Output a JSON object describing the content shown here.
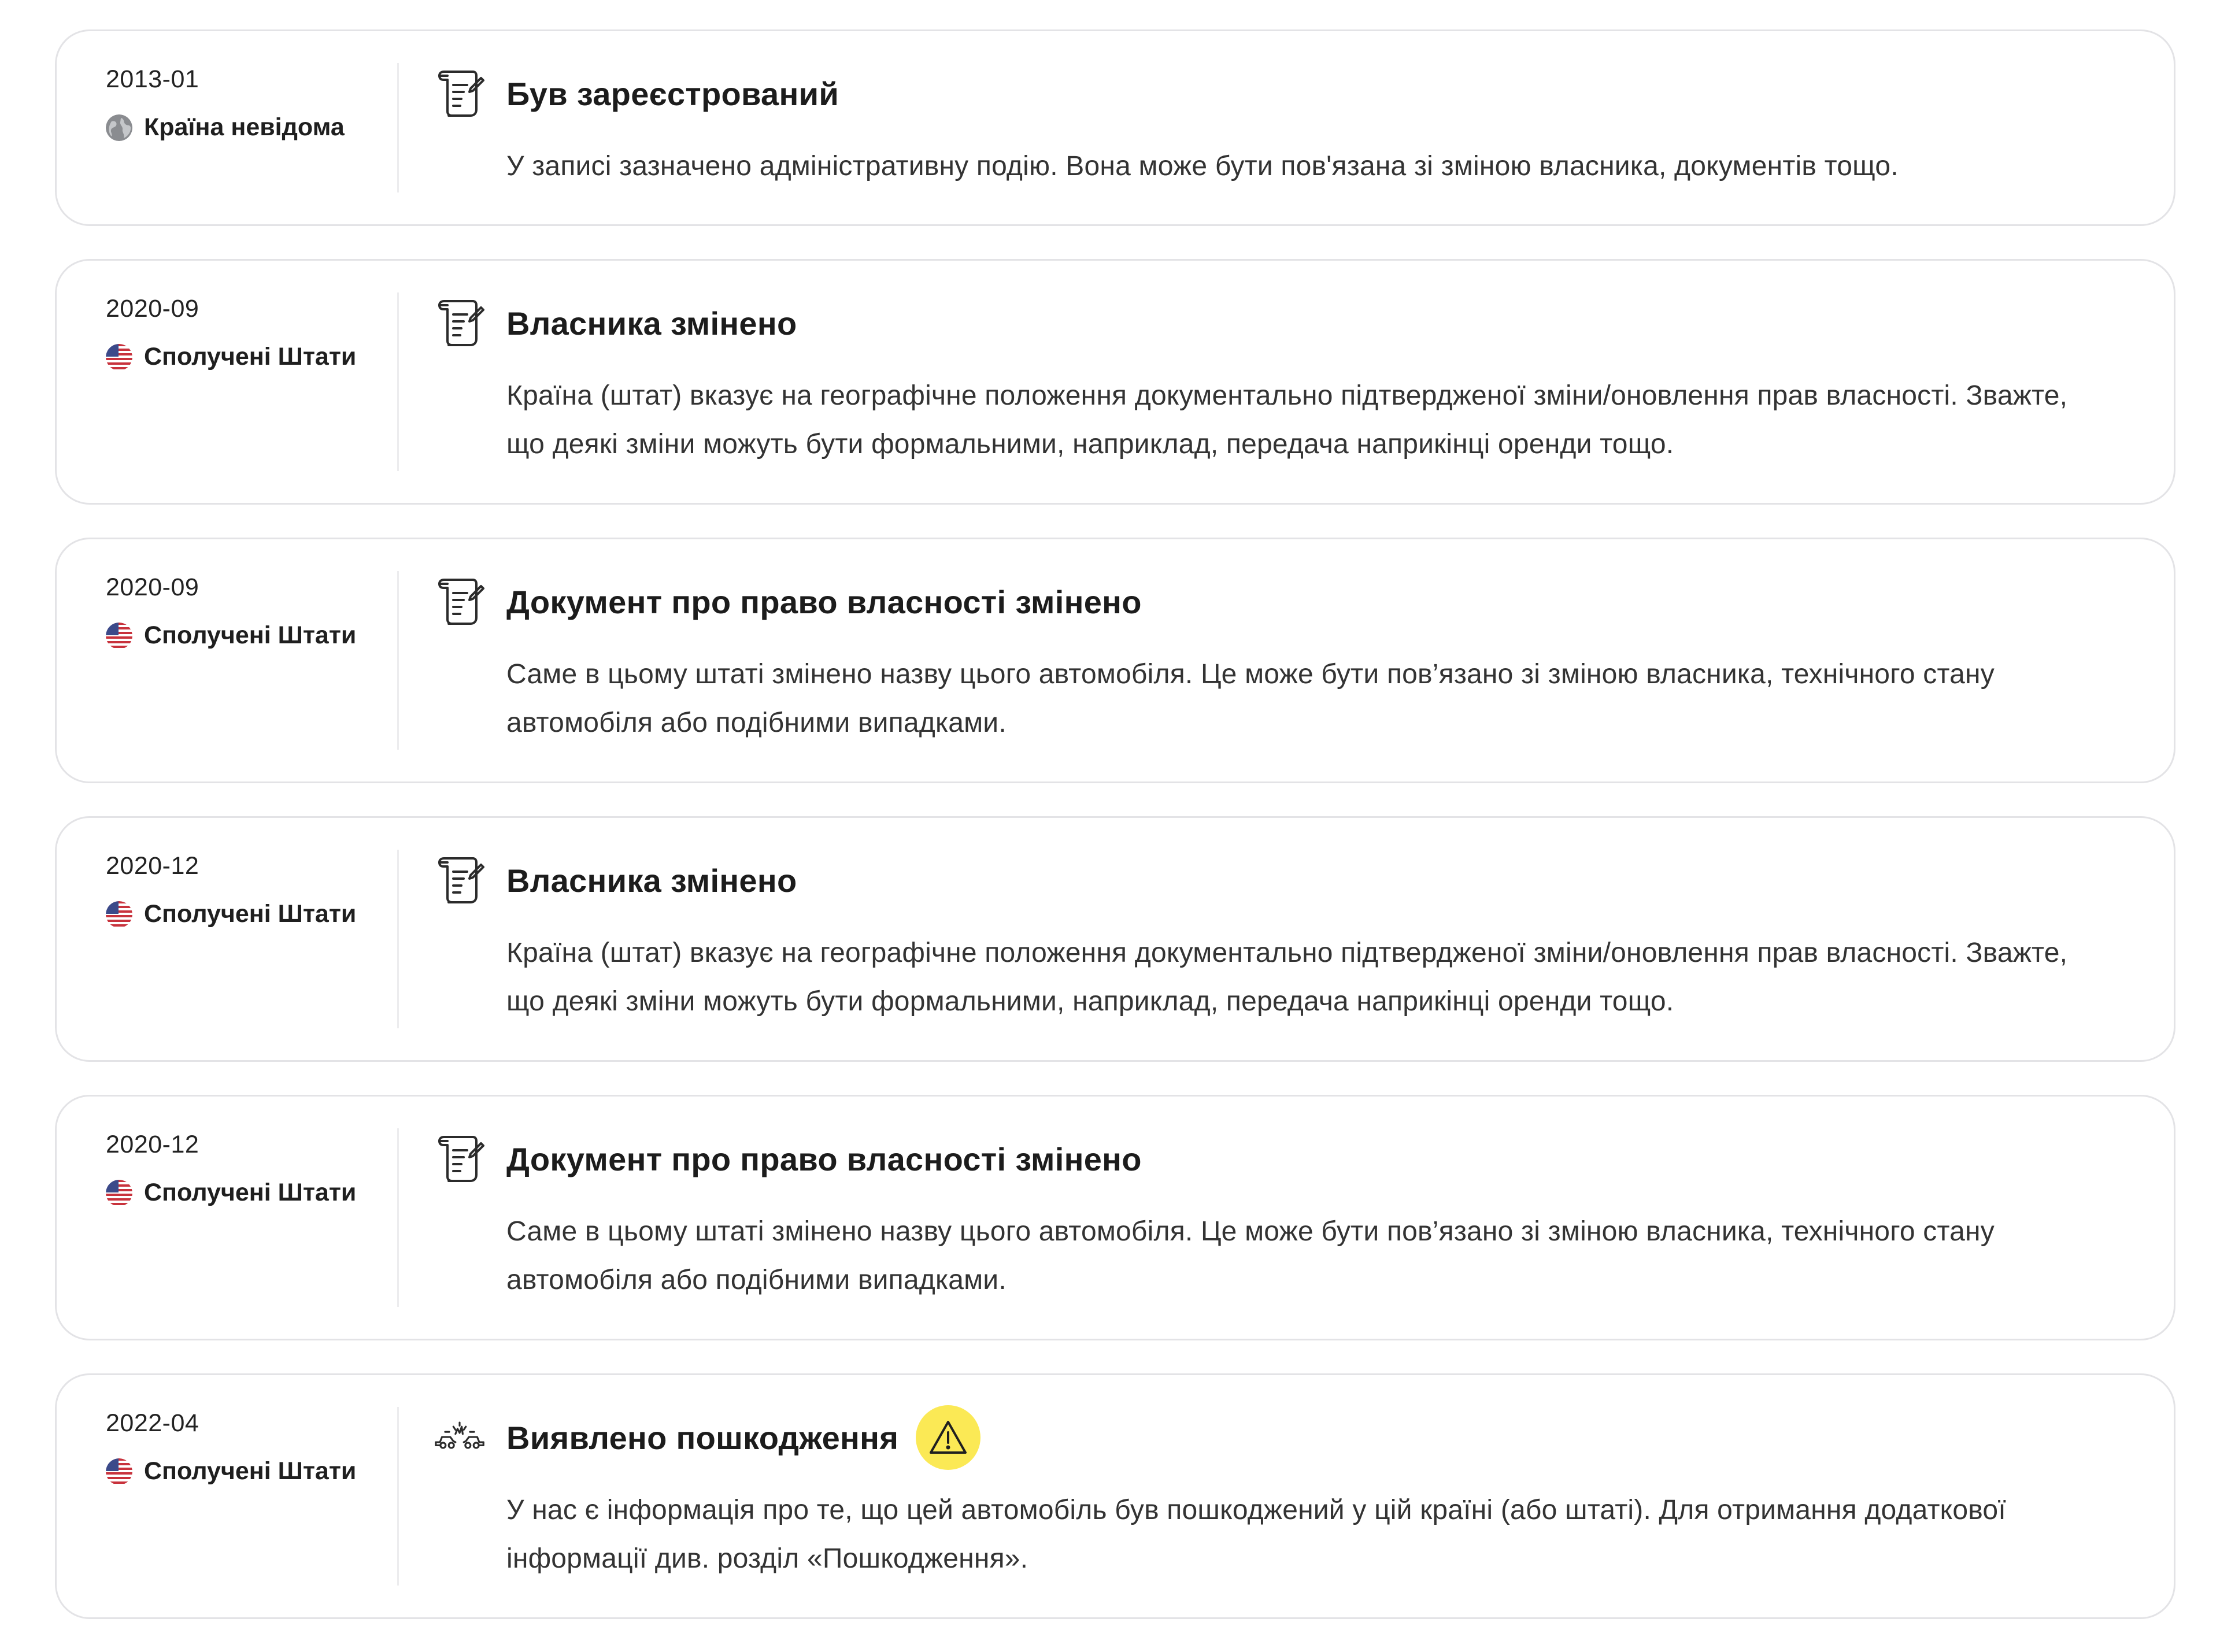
{
  "events": [
    {
      "date": "2013-01",
      "country": "Країна невідома",
      "flag": "globe-icon",
      "icon": "document-scroll-icon",
      "title": "Був зареєстрований",
      "description": "У записі зазначено адміністративну подію. Вона може бути пов'язана зі зміною власника, документів тощо."
    },
    {
      "date": "2020-09",
      "country": "Сполучені Штати",
      "flag": "us-flag-icon",
      "icon": "document-scroll-icon",
      "title": "Власника змінено",
      "description": "Країна (штат) вказує на географічне положення документально підтвердженої зміни/оновлення прав власності. Зважте, що деякі зміни можуть бути формальними, наприклад, передача наприкінці оренди тощо."
    },
    {
      "date": "2020-09",
      "country": "Сполучені Штати",
      "flag": "us-flag-icon",
      "icon": "document-scroll-icon",
      "title": "Документ про право власності змінено",
      "description": "Саме в цьому штаті змінено назву цього автомобіля. Це може бути пов’язано зі зміною власника, технічного стану автомобіля або подібними випадками."
    },
    {
      "date": "2020-12",
      "country": "Сполучені Штати",
      "flag": "us-flag-icon",
      "icon": "document-scroll-icon",
      "title": "Власника змінено",
      "description": "Країна (штат) вказує на географічне положення документально підтвердженої зміни/оновлення прав власності. Зважте, що деякі зміни можуть бути формальними, наприклад, передача наприкінці оренди тощо."
    },
    {
      "date": "2020-12",
      "country": "Сполучені Штати",
      "flag": "us-flag-icon",
      "icon": "document-scroll-icon",
      "title": "Документ про право власності змінено",
      "description": "Саме в цьому штаті змінено назву цього автомобіля. Це може бути пов’язано зі зміною власника, технічного стану автомобіля або подібними випадками."
    },
    {
      "date": "2022-04",
      "country": "Сполучені Штати",
      "flag": "us-flag-icon",
      "icon": "car-crash-icon",
      "title": "Виявлено пошкодження",
      "warning_icon": "warning-triangle-icon",
      "warning_color": "#fbe955",
      "description": "У нас є інформація про те, що цей автомобіль був пошкоджений у цій країні (або штаті). Для отримання додаткової інформації див. розділ «Пошкодження»."
    }
  ]
}
